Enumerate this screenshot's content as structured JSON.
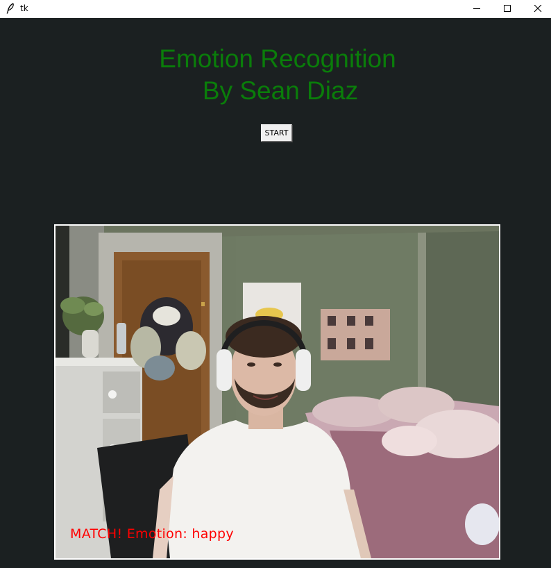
{
  "window": {
    "title": "tk",
    "icon": "feather-icon",
    "controls": [
      "minimize-icon",
      "maximize-icon",
      "close-icon"
    ]
  },
  "heading": {
    "line1": "Emotion Recognition",
    "line2": "By Sean Diaz",
    "color": "#0a7d0a"
  },
  "start_button": {
    "label": "START"
  },
  "video": {
    "overlay_text": "MATCH! Emotion: happy",
    "overlay_color": "#ff0000",
    "border_color": "#ffffff"
  },
  "colors": {
    "background": "#1b2021",
    "titlebar": "#ffffff"
  }
}
